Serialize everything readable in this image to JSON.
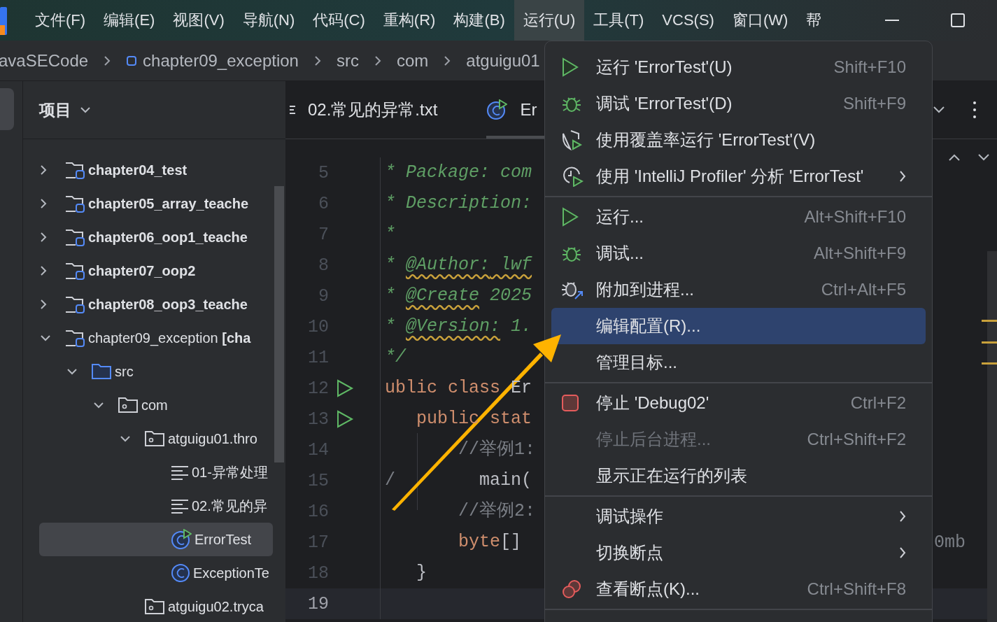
{
  "menubar": {
    "items": [
      {
        "label": "文件(F)",
        "selected": false
      },
      {
        "label": "编辑(E)",
        "selected": false
      },
      {
        "label": "视图(V)",
        "selected": false
      },
      {
        "label": "导航(N)",
        "selected": false
      },
      {
        "label": "代码(C)",
        "selected": false
      },
      {
        "label": "重构(R)",
        "selected": false
      },
      {
        "label": "构建(B)",
        "selected": false
      },
      {
        "label": "运行(U)",
        "selected": true
      },
      {
        "label": "工具(T)",
        "selected": false
      },
      {
        "label": "VCS(S)",
        "selected": false
      },
      {
        "label": "窗口(W)",
        "selected": false
      },
      {
        "label": "帮",
        "selected": false
      }
    ]
  },
  "breadcrumb": [
    {
      "label": "avaSECode",
      "kind": "text"
    },
    {
      "label": "chapter09_exception",
      "kind": "module"
    },
    {
      "label": "src",
      "kind": "text"
    },
    {
      "label": "com",
      "kind": "text"
    },
    {
      "label": "atguigu01",
      "kind": "text"
    }
  ],
  "project": {
    "title": "项目",
    "tree": [
      {
        "label": "chapter04_test",
        "kind": "module",
        "bold": true,
        "expanded": false,
        "selected": false
      },
      {
        "label": "chapter05_array_teache",
        "kind": "module",
        "bold": true,
        "expanded": false,
        "selected": false
      },
      {
        "label": "chapter06_oop1_teache",
        "kind": "module",
        "bold": true,
        "expanded": false,
        "selected": false
      },
      {
        "label": "chapter07_oop2",
        "kind": "module",
        "bold": true,
        "expanded": false,
        "selected": false
      },
      {
        "label": "chapter08_oop3_teache",
        "kind": "module",
        "bold": true,
        "expanded": false,
        "selected": false
      },
      {
        "label": "chapter09_exception **[cha**",
        "kind": "module",
        "bold": false,
        "expanded": true,
        "selected": false,
        "children": [
          {
            "label": "src",
            "kind": "source",
            "bold": false,
            "expanded": true,
            "selected": false,
            "children": [
              {
                "label": "com",
                "kind": "package",
                "bold": false,
                "expanded": true,
                "selected": false,
                "children": [
                  {
                    "label": "atguigu01.thro",
                    "kind": "package",
                    "bold": false,
                    "expanded": true,
                    "selected": false,
                    "children": [
                      {
                        "label": "01-异常处理",
                        "kind": "textfile",
                        "bold": false,
                        "selected": false
                      },
                      {
                        "label": "02.常见的异",
                        "kind": "textfile",
                        "bold": false,
                        "selected": false
                      },
                      {
                        "label": "ErrorTest",
                        "kind": "runclass",
                        "bold": false,
                        "selected": true
                      },
                      {
                        "label": "ExceptionTe",
                        "kind": "class",
                        "bold": false,
                        "selected": false
                      }
                    ]
                  },
                  {
                    "label": "atguigu02.tryca",
                    "kind": "package",
                    "bold": false,
                    "selected": false
                  }
                ]
              }
            ]
          }
        ]
      }
    ]
  },
  "editor": {
    "tabs": [
      {
        "label": "02.常见的异常.txt",
        "kind": "textfile",
        "selected": false
      },
      {
        "label": "Er",
        "kind": "runclass",
        "selected": true
      }
    ],
    "lines": [
      {
        "n": "5",
        "run": false,
        "current": false,
        "segments": [
          {
            "kind": "doc",
            "text": "* Package: com"
          }
        ]
      },
      {
        "n": "6",
        "run": false,
        "current": false,
        "segments": [
          {
            "kind": "doc",
            "text": "* Description:"
          }
        ]
      },
      {
        "n": "7",
        "run": false,
        "current": false,
        "segments": [
          {
            "kind": "doc",
            "text": "*"
          }
        ]
      },
      {
        "n": "8",
        "run": false,
        "current": false,
        "segments": [
          {
            "kind": "doc",
            "text": "* "
          },
          {
            "kind": "tag",
            "text": "@Author:"
          },
          {
            "kind": "tag",
            "text": " lwf"
          }
        ]
      },
      {
        "n": "9",
        "run": false,
        "current": false,
        "segments": [
          {
            "kind": "doc",
            "text": "* "
          },
          {
            "kind": "tag",
            "text": "@Create"
          },
          {
            "kind": "doc",
            "text": " 2025"
          }
        ]
      },
      {
        "n": "10",
        "run": false,
        "current": false,
        "segments": [
          {
            "kind": "doc",
            "text": "* "
          },
          {
            "kind": "tag",
            "text": "@Version:"
          },
          {
            "kind": "doc",
            "text": " 1."
          }
        ]
      },
      {
        "n": "11",
        "run": false,
        "current": false,
        "segments": [
          {
            "kind": "doc",
            "text": "*/"
          }
        ]
      },
      {
        "n": "12",
        "run": true,
        "current": false,
        "segments": [
          {
            "kind": "keyword",
            "text": "ublic class "
          },
          {
            "kind": "plain",
            "text": "Er"
          }
        ]
      },
      {
        "n": "13",
        "run": true,
        "current": false,
        "segments": [
          {
            "kind": "keyword",
            "text": "   public stat"
          }
        ]
      },
      {
        "n": "14",
        "run": false,
        "current": false,
        "segments": [
          {
            "kind": "comment",
            "text": "       //举例1:"
          }
        ]
      },
      {
        "n": "15",
        "run": false,
        "current": false,
        "segments": [
          {
            "kind": "comment",
            "text": "/"
          },
          {
            "kind": "plain",
            "text": "        main("
          }
        ]
      },
      {
        "n": "16",
        "run": false,
        "current": false,
        "segments": [
          {
            "kind": "comment",
            "text": "       //举例2:"
          }
        ]
      },
      {
        "n": "17",
        "run": false,
        "current": false,
        "segments": [
          {
            "kind": "keyword",
            "text": "       byte"
          },
          {
            "kind": "plain",
            "text": "[]"
          }
        ],
        "tail": "0mb"
      },
      {
        "n": "18",
        "run": false,
        "current": false,
        "segments": [
          {
            "kind": "plain",
            "text": "   }"
          }
        ]
      },
      {
        "n": "19",
        "run": false,
        "current": true
      }
    ]
  },
  "run_menu": {
    "items": [
      {
        "kind": "run",
        "label": "运行 'ErrorTest'(U)",
        "shortcut": "Shift+F10",
        "submenu": false,
        "disabled": false,
        "selected": false
      },
      {
        "kind": "debug",
        "label": "调试 'ErrorTest'(D)",
        "shortcut": "Shift+F9",
        "submenu": false,
        "disabled": false,
        "selected": false
      },
      {
        "kind": "coverage",
        "label": "使用覆盖率运行 'ErrorTest'(V)",
        "submenu": false,
        "disabled": false,
        "selected": false
      },
      {
        "kind": "profiler",
        "label": "使用 'IntelliJ Profiler' 分析  'ErrorTest'",
        "submenu": true,
        "disabled": false,
        "selected": false
      },
      {
        "kind": "separator"
      },
      {
        "kind": "run",
        "label": "运行...",
        "shortcut": "Alt+Shift+F10",
        "submenu": false,
        "disabled": false,
        "selected": false
      },
      {
        "kind": "debug",
        "label": "调试...",
        "shortcut": "Alt+Shift+F9",
        "submenu": false,
        "disabled": false,
        "selected": false
      },
      {
        "kind": "attach",
        "label": "附加到进程...",
        "shortcut": "Ctrl+Alt+F5",
        "submenu": false,
        "disabled": false,
        "selected": false
      },
      {
        "kind": "plain",
        "label": "编辑配置(R)...",
        "submenu": false,
        "disabled": false,
        "selected": true
      },
      {
        "kind": "plain",
        "label": "管理目标...",
        "submenu": false,
        "disabled": false,
        "selected": false
      },
      {
        "kind": "separator"
      },
      {
        "kind": "stop",
        "label": "停止 'Debug02'",
        "shortcut": "Ctrl+F2",
        "submenu": false,
        "disabled": false,
        "selected": false
      },
      {
        "kind": "plain",
        "label": "停止后台进程...",
        "shortcut": "Ctrl+Shift+F2",
        "submenu": false,
        "disabled": true,
        "selected": false
      },
      {
        "kind": "plain",
        "label": "显示正在运行的列表",
        "submenu": false,
        "disabled": false,
        "selected": false
      },
      {
        "kind": "separator"
      },
      {
        "kind": "plain",
        "label": "调试操作",
        "submenu": true,
        "disabled": false,
        "selected": false
      },
      {
        "kind": "plain",
        "label": "切换断点",
        "submenu": true,
        "disabled": false,
        "selected": false
      },
      {
        "kind": "breakpoints",
        "label": "查看断点(K)...",
        "shortcut": "Ctrl+Shift+F8",
        "submenu": false,
        "disabled": false,
        "selected": false
      },
      {
        "kind": "separator"
      }
    ]
  }
}
